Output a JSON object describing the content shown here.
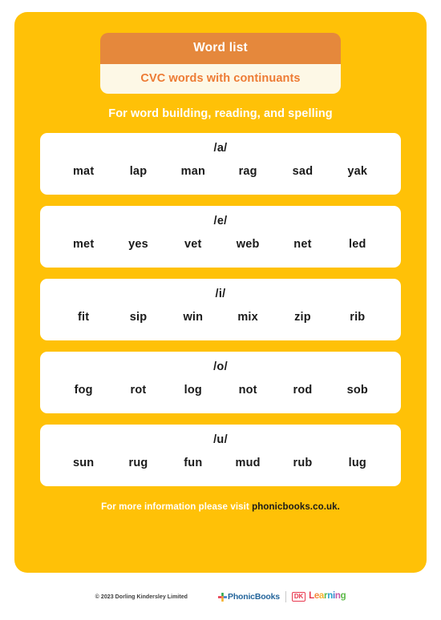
{
  "poster": {
    "title_top": "Word list",
    "title_bottom": "CVC words with continuants",
    "subtitle": "For word building, reading, and spelling",
    "footer_prefix": "For more information please visit ",
    "footer_url": "phonicbooks.co.uk.",
    "background_color": "#FFC107",
    "title_top_color": "#E5883C",
    "title_bottom_bg": "#FDF8E6",
    "title_bottom_color": "#ED7B34"
  },
  "word_cards": [
    {
      "phoneme": "/a/",
      "words": [
        "mat",
        "lap",
        "man",
        "rag",
        "sad",
        "yak"
      ]
    },
    {
      "phoneme": "/e/",
      "words": [
        "met",
        "yes",
        "vet",
        "web",
        "net",
        "led"
      ]
    },
    {
      "phoneme": "/i/",
      "words": [
        "fit",
        "sip",
        "win",
        "mix",
        "zip",
        "rib"
      ]
    },
    {
      "phoneme": "/o/",
      "words": [
        "fog",
        "rot",
        "log",
        "not",
        "rod",
        "sob"
      ]
    },
    {
      "phoneme": "/u/",
      "words": [
        "sun",
        "rug",
        "fun",
        "mud",
        "rub",
        "lug"
      ]
    }
  ],
  "credit": {
    "copyright": "© 2023 Dorling Kindersley Limited",
    "phonic_books_label": "PhonicBooks",
    "dk_badge_label": "DK",
    "dk_learning_letters": [
      {
        "char": "L",
        "color": "#E8384F"
      },
      {
        "char": "e",
        "color": "#F5883C"
      },
      {
        "char": "a",
        "color": "#F5B22D"
      },
      {
        "char": "r",
        "color": "#5BB947"
      },
      {
        "char": "n",
        "color": "#29A3C9"
      },
      {
        "char": "i",
        "color": "#3D7FD1"
      },
      {
        "char": "n",
        "color": "#C557A6"
      },
      {
        "char": "g",
        "color": "#5BB947"
      }
    ]
  }
}
